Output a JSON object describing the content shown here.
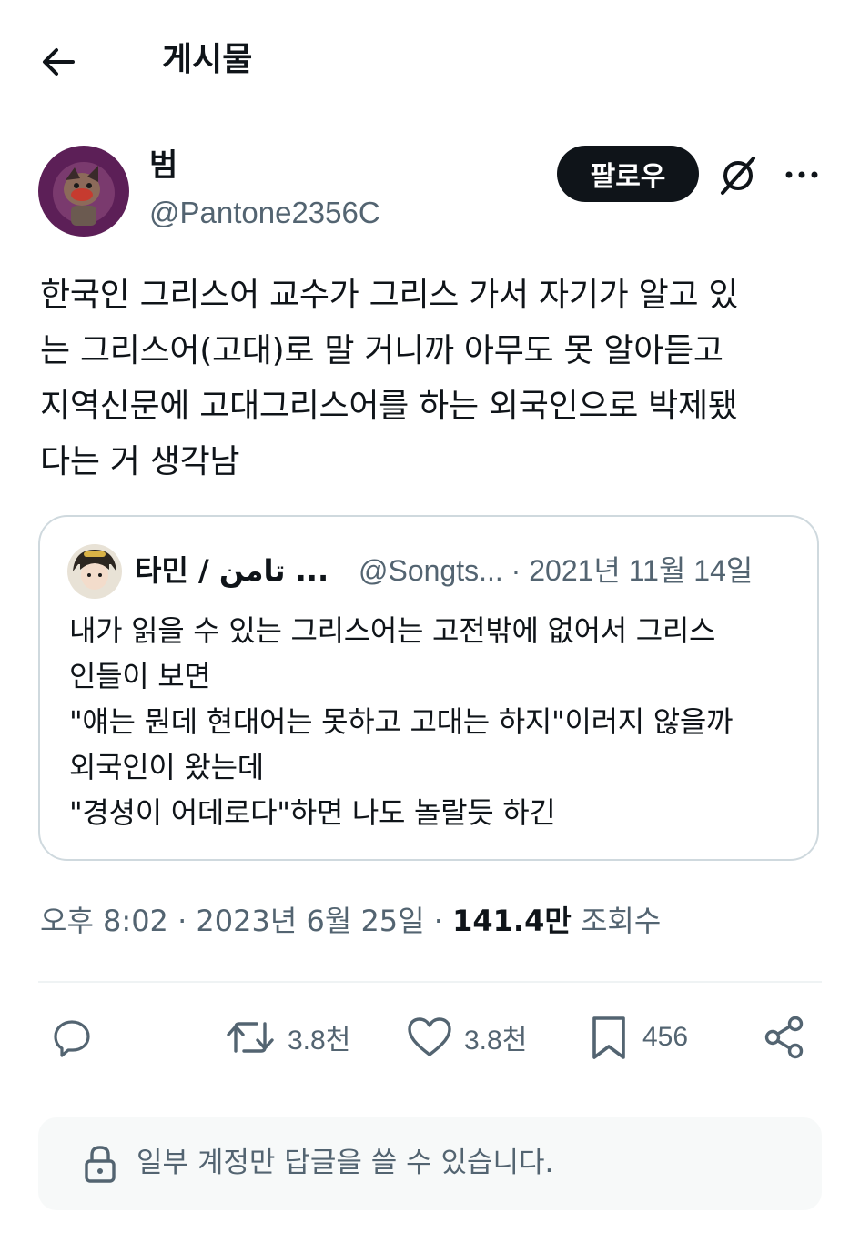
{
  "header": {
    "title": "게시물",
    "back_icon": "arrow-left-icon"
  },
  "author": {
    "name": "범",
    "handle": "@Pantone2356C",
    "follow_label": "팔로우"
  },
  "post": {
    "text": "한국인 그리스어 교수가 그리스 가서 자기가 알고 있\n는 그리스어(고대)로 말 거니까 아무도 못 알아듣고\n지역신문에 고대그리스어를 하는 외국인으로 박제됐\n다는 거 생각남"
  },
  "quote": {
    "name": "타민 / تامن ...",
    "meta": "@Songts... · 2021년 11월 14일",
    "text": "내가 읽을 수 있는 그리스어는 고전밖에 없어서 그리스\n인들이 보면\n\"얘는 뭔데 현대어는 못하고 고대는 하지\"이러지 않을까\n외국인이 왔는데\n\"경셩이 어데로다\"하면 나도 놀랄듯 하긴"
  },
  "meta": {
    "time": "오후 8:02 · 2023년 6월 25일 · ",
    "views": "141.4만",
    "views_label": " 조회수"
  },
  "actions": {
    "retweets": "3.8천",
    "likes": "3.8천",
    "bookmarks": "456"
  },
  "notice": {
    "text": "일부 계정만 답글을 쓸 수 있습니다."
  },
  "colors": {
    "text": "#0f1419",
    "muted": "#536471",
    "border": "#cfd9de",
    "notice_bg": "#f7f9f9"
  }
}
